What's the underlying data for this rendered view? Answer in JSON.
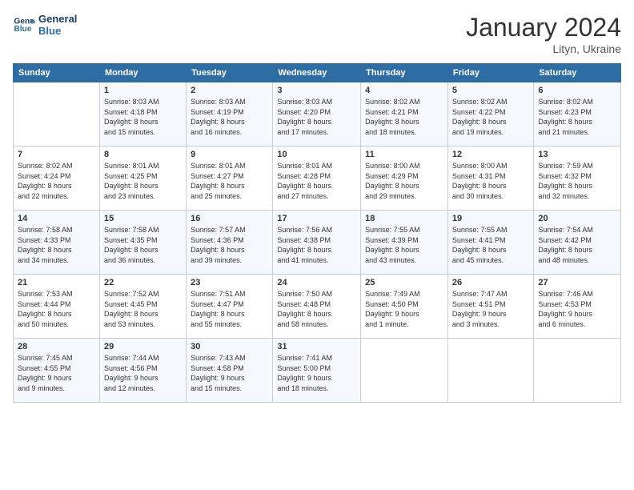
{
  "header": {
    "logo_line1": "General",
    "logo_line2": "Blue",
    "month_title": "January 2024",
    "location": "Lityn, Ukraine"
  },
  "weekdays": [
    "Sunday",
    "Monday",
    "Tuesday",
    "Wednesday",
    "Thursday",
    "Friday",
    "Saturday"
  ],
  "weeks": [
    [
      {
        "num": "",
        "info": ""
      },
      {
        "num": "1",
        "info": "Sunrise: 8:03 AM\nSunset: 4:18 PM\nDaylight: 8 hours\nand 15 minutes."
      },
      {
        "num": "2",
        "info": "Sunrise: 8:03 AM\nSunset: 4:19 PM\nDaylight: 8 hours\nand 16 minutes."
      },
      {
        "num": "3",
        "info": "Sunrise: 8:03 AM\nSunset: 4:20 PM\nDaylight: 8 hours\nand 17 minutes."
      },
      {
        "num": "4",
        "info": "Sunrise: 8:02 AM\nSunset: 4:21 PM\nDaylight: 8 hours\nand 18 minutes."
      },
      {
        "num": "5",
        "info": "Sunrise: 8:02 AM\nSunset: 4:22 PM\nDaylight: 8 hours\nand 19 minutes."
      },
      {
        "num": "6",
        "info": "Sunrise: 8:02 AM\nSunset: 4:23 PM\nDaylight: 8 hours\nand 21 minutes."
      }
    ],
    [
      {
        "num": "7",
        "info": "Sunrise: 8:02 AM\nSunset: 4:24 PM\nDaylight: 8 hours\nand 22 minutes."
      },
      {
        "num": "8",
        "info": "Sunrise: 8:01 AM\nSunset: 4:25 PM\nDaylight: 8 hours\nand 23 minutes."
      },
      {
        "num": "9",
        "info": "Sunrise: 8:01 AM\nSunset: 4:27 PM\nDaylight: 8 hours\nand 25 minutes."
      },
      {
        "num": "10",
        "info": "Sunrise: 8:01 AM\nSunset: 4:28 PM\nDaylight: 8 hours\nand 27 minutes."
      },
      {
        "num": "11",
        "info": "Sunrise: 8:00 AM\nSunset: 4:29 PM\nDaylight: 8 hours\nand 29 minutes."
      },
      {
        "num": "12",
        "info": "Sunrise: 8:00 AM\nSunset: 4:31 PM\nDaylight: 8 hours\nand 30 minutes."
      },
      {
        "num": "13",
        "info": "Sunrise: 7:59 AM\nSunset: 4:32 PM\nDaylight: 8 hours\nand 32 minutes."
      }
    ],
    [
      {
        "num": "14",
        "info": "Sunrise: 7:58 AM\nSunset: 4:33 PM\nDaylight: 8 hours\nand 34 minutes."
      },
      {
        "num": "15",
        "info": "Sunrise: 7:58 AM\nSunset: 4:35 PM\nDaylight: 8 hours\nand 36 minutes."
      },
      {
        "num": "16",
        "info": "Sunrise: 7:57 AM\nSunset: 4:36 PM\nDaylight: 8 hours\nand 39 minutes."
      },
      {
        "num": "17",
        "info": "Sunrise: 7:56 AM\nSunset: 4:38 PM\nDaylight: 8 hours\nand 41 minutes."
      },
      {
        "num": "18",
        "info": "Sunrise: 7:55 AM\nSunset: 4:39 PM\nDaylight: 8 hours\nand 43 minutes."
      },
      {
        "num": "19",
        "info": "Sunrise: 7:55 AM\nSunset: 4:41 PM\nDaylight: 8 hours\nand 45 minutes."
      },
      {
        "num": "20",
        "info": "Sunrise: 7:54 AM\nSunset: 4:42 PM\nDaylight: 8 hours\nand 48 minutes."
      }
    ],
    [
      {
        "num": "21",
        "info": "Sunrise: 7:53 AM\nSunset: 4:44 PM\nDaylight: 8 hours\nand 50 minutes."
      },
      {
        "num": "22",
        "info": "Sunrise: 7:52 AM\nSunset: 4:45 PM\nDaylight: 8 hours\nand 53 minutes."
      },
      {
        "num": "23",
        "info": "Sunrise: 7:51 AM\nSunset: 4:47 PM\nDaylight: 8 hours\nand 55 minutes."
      },
      {
        "num": "24",
        "info": "Sunrise: 7:50 AM\nSunset: 4:48 PM\nDaylight: 8 hours\nand 58 minutes."
      },
      {
        "num": "25",
        "info": "Sunrise: 7:49 AM\nSunset: 4:50 PM\nDaylight: 9 hours\nand 1 minute."
      },
      {
        "num": "26",
        "info": "Sunrise: 7:47 AM\nSunset: 4:51 PM\nDaylight: 9 hours\nand 3 minutes."
      },
      {
        "num": "27",
        "info": "Sunrise: 7:46 AM\nSunset: 4:53 PM\nDaylight: 9 hours\nand 6 minutes."
      }
    ],
    [
      {
        "num": "28",
        "info": "Sunrise: 7:45 AM\nSunset: 4:55 PM\nDaylight: 9 hours\nand 9 minutes."
      },
      {
        "num": "29",
        "info": "Sunrise: 7:44 AM\nSunset: 4:56 PM\nDaylight: 9 hours\nand 12 minutes."
      },
      {
        "num": "30",
        "info": "Sunrise: 7:43 AM\nSunset: 4:58 PM\nDaylight: 9 hours\nand 15 minutes."
      },
      {
        "num": "31",
        "info": "Sunrise: 7:41 AM\nSunset: 5:00 PM\nDaylight: 9 hours\nand 18 minutes."
      },
      {
        "num": "",
        "info": ""
      },
      {
        "num": "",
        "info": ""
      },
      {
        "num": "",
        "info": ""
      }
    ]
  ]
}
